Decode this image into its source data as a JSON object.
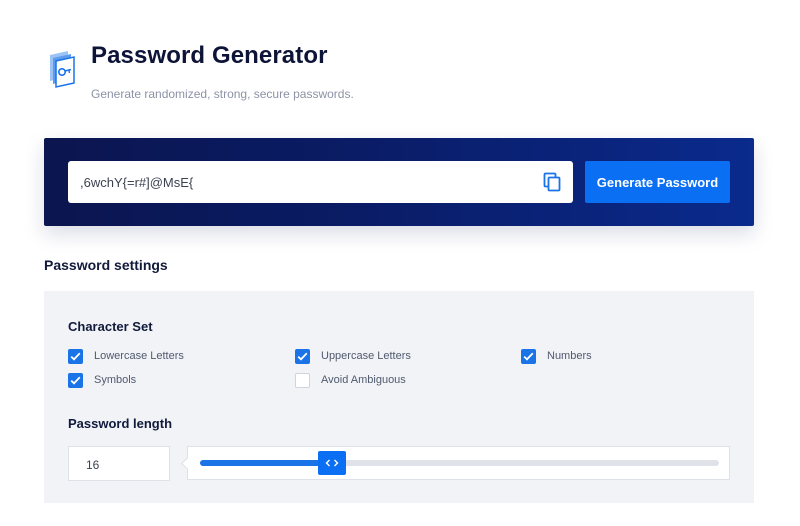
{
  "header": {
    "title": "Password Generator",
    "subtitle": "Generate randomized, strong, secure passwords.",
    "logo_icon": "key-document-icon"
  },
  "generator": {
    "password_value": ",6wchY{=r#]@MsE{",
    "copy_icon": "copy-icon",
    "generate_label": "Generate Password"
  },
  "settings": {
    "heading": "Password settings",
    "character_set_label": "Character Set",
    "options": [
      {
        "label": "Lowercase Letters",
        "checked": true
      },
      {
        "label": "Uppercase Letters",
        "checked": true
      },
      {
        "label": "Numbers",
        "checked": true
      },
      {
        "label": "Symbols",
        "checked": true
      },
      {
        "label": "Avoid Ambiguous",
        "checked": false
      }
    ],
    "length_label": "Password length",
    "length_value": "16",
    "slider_fraction": 0.255
  },
  "colors": {
    "accent": "#0b6ff3",
    "panel_dark": "#0b154f",
    "panel_light": "#f1f3f7"
  }
}
